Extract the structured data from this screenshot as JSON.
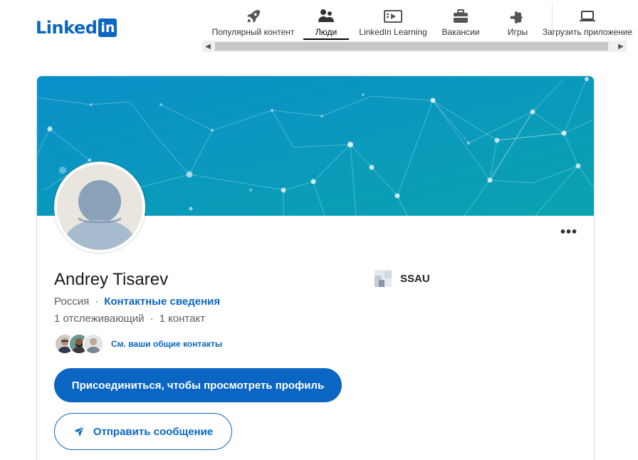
{
  "brand": {
    "word": "Linked",
    "box": "in"
  },
  "nav": {
    "items": [
      {
        "label": "Популярный контент",
        "icon": "rocket-icon"
      },
      {
        "label": "Люди",
        "icon": "people-icon",
        "active": true
      },
      {
        "label": "LinkedIn Learning",
        "icon": "learning-video-icon"
      },
      {
        "label": "Вакансии",
        "icon": "briefcase-icon"
      },
      {
        "label": "Игры",
        "icon": "puzzle-icon"
      },
      {
        "label": "Загрузить приложение",
        "icon": "laptop-icon"
      }
    ]
  },
  "profile": {
    "name": "Andrey Tisarev",
    "location": "Россия",
    "contact_link": "Контактные сведения",
    "followers": "1 отслеживающий",
    "connections": "1 контакт",
    "mutual_text": "См. ваши общие контакты",
    "join_button": "Присоединиться, чтобы просмотреть профиль",
    "message_button": "Отправить сообщение",
    "more_label": "•••",
    "education": "SSAU"
  },
  "colors": {
    "brand": "#0a66c2",
    "banner_start": "#0a8fc9",
    "banner_end": "#0aa3b0"
  }
}
